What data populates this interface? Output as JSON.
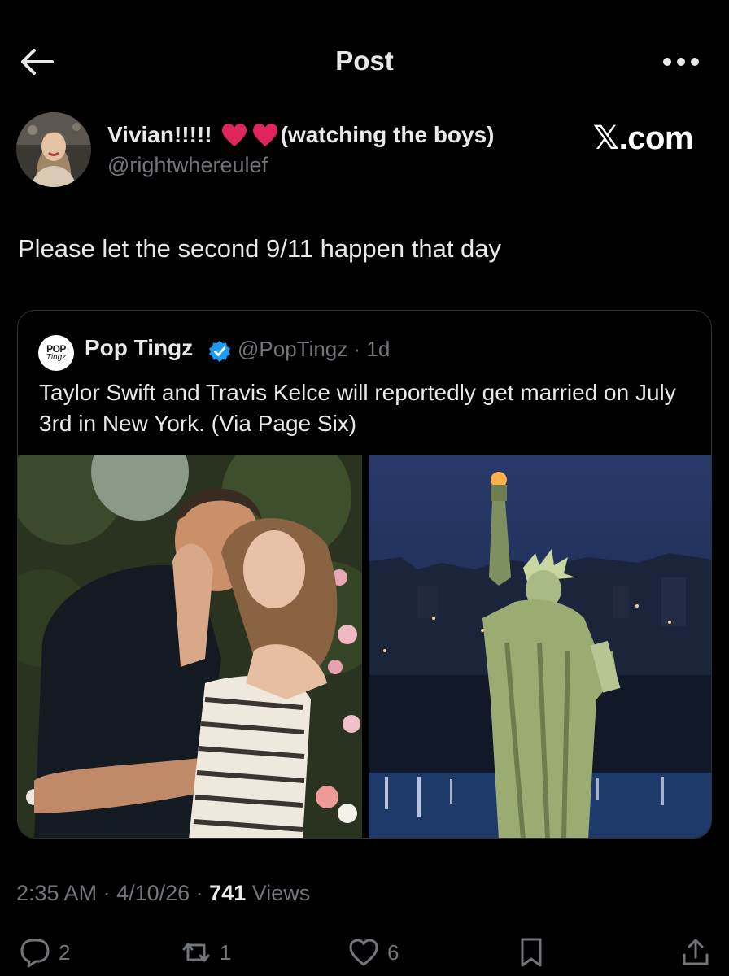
{
  "header": {
    "title": "Post"
  },
  "post": {
    "author_name_prefix": "Vivian!!!!!",
    "author_name_suffix": "(watching the boys)",
    "author_handle": "@rightwhereulef",
    "source_badge": "𝕏.com",
    "text": "Please let the second 9/11 happen that day",
    "timestamp": "2:35 AM",
    "date": "4/10/26",
    "views_count": "741",
    "views_label": "Views"
  },
  "quote": {
    "avatar_line1": "POP",
    "avatar_line2": "Tingz",
    "name": "Pop Tingz",
    "handle": "@PopTingz",
    "age": "1d",
    "text": "Taylor Swift and Travis Kelce will reportedly get married on July 3rd in New York. (Via Page Six)"
  },
  "actions": {
    "replies": "2",
    "reposts": "1",
    "likes": "6"
  },
  "colors": {
    "background": "#000000",
    "text": "#e7e9ea",
    "muted": "#71767b",
    "heart": "#e0245e",
    "verified": "#1d9bf0",
    "border": "#2f3336"
  },
  "icons": {
    "back": "arrow-left-icon",
    "more": "more-dots-icon",
    "verified": "verified-badge-icon",
    "reply": "reply-icon",
    "repost": "repost-icon",
    "like": "heart-icon",
    "bookmark": "bookmark-icon",
    "share": "share-icon"
  }
}
